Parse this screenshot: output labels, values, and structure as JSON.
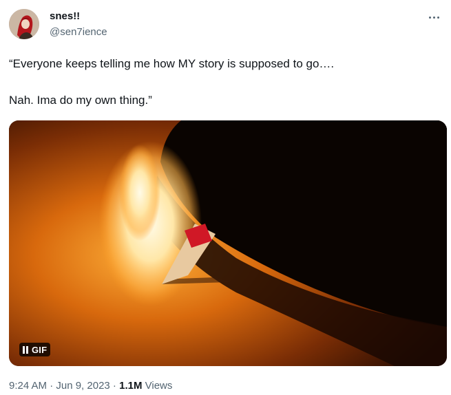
{
  "tweet": {
    "display_name": "snes!!",
    "handle": "@sen7ience",
    "text_line1": "“Everyone keeps telling me how MY story is supposed to go….",
    "text_line2": "Nah. Ima do my own thing.”",
    "media": {
      "badge_label": "GIF"
    },
    "timestamp": "9:24 AM · Jun 9, 2023 ·",
    "views_count": "1.1M",
    "views_label": "Views"
  },
  "icons": {
    "more": "more-horizontal-icon",
    "pause": "pause-icon"
  }
}
